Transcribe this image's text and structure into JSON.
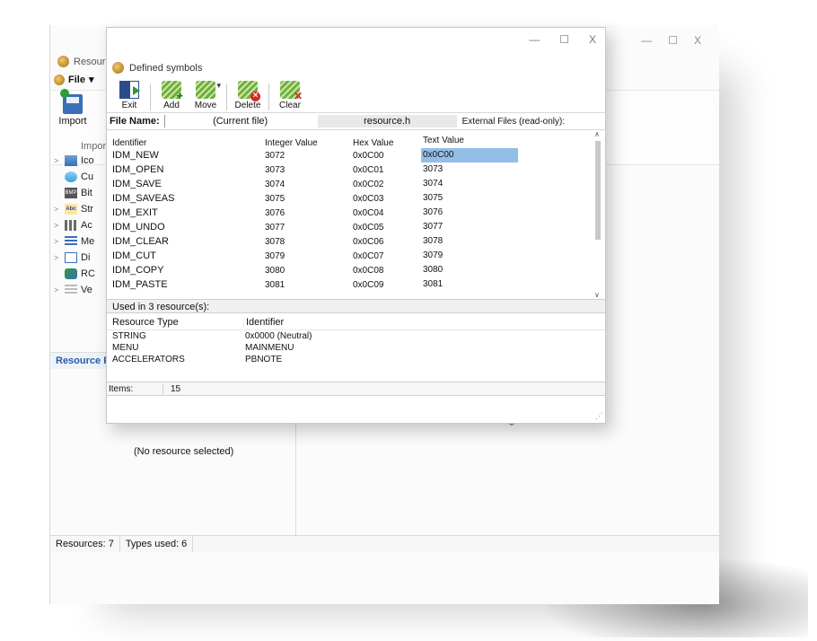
{
  "main_window": {
    "title": "Resourc",
    "menu_file": "File",
    "ribbon": {
      "import_label": "Import",
      "group_label": "Impor"
    },
    "tree": [
      {
        "label": "Ico",
        "icon": "icon-resource-icon",
        "expandable": true
      },
      {
        "label": "Cu",
        "icon": "cursor-icon",
        "expandable": false
      },
      {
        "label": "Bit",
        "icon": "bitmap-icon",
        "expandable": false
      },
      {
        "label": "Str",
        "icon": "string-table-icon",
        "expandable": true
      },
      {
        "label": "Ac",
        "icon": "accelerator-icon",
        "expandable": true
      },
      {
        "label": "Me",
        "icon": "menu-icon",
        "expandable": true
      },
      {
        "label": "Di",
        "icon": "dialog-icon",
        "expandable": true
      },
      {
        "label": "RC",
        "icon": "rcdata-icon",
        "expandable": false
      },
      {
        "label": "Ve",
        "icon": "version-icon",
        "expandable": true
      }
    ],
    "properties_header": "Resource P",
    "no_resource_text": "(No resource selected)",
    "status": {
      "resources": "Resources: 7",
      "types_used": "Types used: 6"
    },
    "window_controls": [
      "—",
      "☐",
      "X"
    ]
  },
  "dialog": {
    "title": "Defined symbols",
    "window_controls": [
      "—",
      "☐",
      "X"
    ],
    "toolbar": {
      "exit": "Exit",
      "add": "Add",
      "move": "Move",
      "delete": "Delete",
      "clear": "Clear"
    },
    "file_bar": {
      "label": "File Name:",
      "current": "(Current file)",
      "resource_tab": "resource.h",
      "external_tab": "External Files (read-only):"
    },
    "columns": {
      "identifier": "Identifier",
      "integer": "Integer Value",
      "hex": "Hex Value",
      "text": "Text Value"
    },
    "rows": [
      {
        "id": "IDM_NEW",
        "int": "3072",
        "hex": "0x0C00",
        "text": "0x0C00"
      },
      {
        "id": "IDM_OPEN",
        "int": "3073",
        "hex": "0x0C01",
        "text": "3073"
      },
      {
        "id": "IDM_SAVE",
        "int": "3074",
        "hex": "0x0C02",
        "text": "3074"
      },
      {
        "id": "IDM_SAVEAS",
        "int": "3075",
        "hex": "0x0C03",
        "text": "3075"
      },
      {
        "id": "IDM_EXIT",
        "int": "3076",
        "hex": "0x0C04",
        "text": "3076"
      },
      {
        "id": "IDM_UNDO",
        "int": "3077",
        "hex": "0x0C05",
        "text": "3077"
      },
      {
        "id": "IDM_CLEAR",
        "int": "3078",
        "hex": "0x0C06",
        "text": "3078"
      },
      {
        "id": "IDM_CUT",
        "int": "3079",
        "hex": "0x0C07",
        "text": "3079"
      },
      {
        "id": "IDM_COPY",
        "int": "3080",
        "hex": "0x0C08",
        "text": "3080"
      },
      {
        "id": "IDM_PASTE",
        "int": "3081",
        "hex": "0x0C09",
        "text": "3081"
      }
    ],
    "used_in": "Used in 3 resource(s):",
    "used_columns": {
      "type": "Resource Type",
      "identifier": "Identifier"
    },
    "used_rows": [
      {
        "type": "STRING",
        "identifier": "0x0000 (Neutral)"
      },
      {
        "type": "MENU",
        "identifier": "MAINMENU"
      },
      {
        "type": "ACCELERATORS",
        "identifier": "PBNOTE"
      }
    ],
    "status": {
      "items_label": "Items:",
      "items_value": "15"
    }
  },
  "colors": {
    "selection": "#93bfe6",
    "link_header": "#2a5aa8"
  }
}
